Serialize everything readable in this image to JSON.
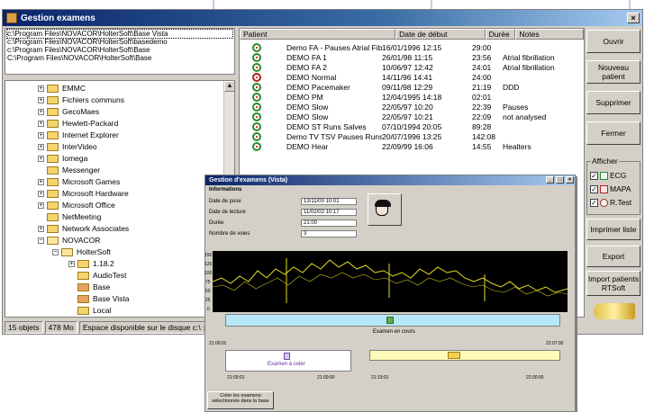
{
  "window": {
    "title": "Gestion examens",
    "close_glyph": "×"
  },
  "paths": [
    "c:\\Program Files\\NOVACOR\\HolterSoft\\Base Vista",
    "c:\\Program Files\\NOVACOR\\HolterSoft\\basedemo",
    "c:\\Program Files\\NOVACOR\\HolterSoft\\Base",
    "C:\\Program Files\\NOVACOR\\HolterSoft\\Base"
  ],
  "tree": {
    "items": [
      {
        "label": "EMMC",
        "pm": "+"
      },
      {
        "label": "Fichiers communs",
        "pm": "+"
      },
      {
        "label": "GecoMaes",
        "pm": "+"
      },
      {
        "label": "Hewlett-Packard",
        "pm": "+"
      },
      {
        "label": "Internet Explorer",
        "pm": "+"
      },
      {
        "label": "InterVideo",
        "pm": "+"
      },
      {
        "label": "Iomega",
        "pm": "+"
      },
      {
        "label": "Messenger",
        "pm": ""
      },
      {
        "label": "Microsoft Games",
        "pm": "+"
      },
      {
        "label": "Microsoft Hardware",
        "pm": "+"
      },
      {
        "label": "Microsoft Office",
        "pm": "+"
      },
      {
        "label": "NetMeeting",
        "pm": ""
      },
      {
        "label": "Network Associates",
        "pm": "+"
      },
      {
        "label": "NOVACOR",
        "pm": "−"
      },
      {
        "label": "HolterSoft",
        "pm": "−"
      },
      {
        "label": "1.18.2",
        "pm": "+"
      },
      {
        "label": "AudioTest",
        "pm": ""
      },
      {
        "label": "Base",
        "pm": ""
      },
      {
        "label": "Base Vista",
        "pm": ""
      },
      {
        "label": "Local",
        "pm": ""
      }
    ],
    "scroll_up": "▲"
  },
  "status": {
    "objects": "15 objets",
    "size": "478 Mo",
    "disk": "Espace disponible sur le disque c:\\ :"
  },
  "table": {
    "headers": [
      "Patient",
      "Date de début",
      "Durée",
      "Notes"
    ],
    "rows": [
      {
        "patient": "Demo FA - Pauses Atrial Fibrill...",
        "date": "16/01/1996 12:15",
        "duree": "29:00",
        "notes": ""
      },
      {
        "patient": "DEMO FA 1",
        "date": "26/01/98 11:15",
        "duree": "23:56",
        "notes": "Atrial fibrillation"
      },
      {
        "patient": "DEMO FA 2",
        "date": "10/06/97 12:42",
        "duree": "24:01",
        "notes": "Atrial fibrillation"
      },
      {
        "patient": "DEMO Normal",
        "date": "14/11/96 14:41",
        "duree": "24:00",
        "notes": ""
      },
      {
        "patient": "DEMO Pacemaker",
        "date": "09/11/98 12:29",
        "duree": "21:19",
        "notes": "DDD"
      },
      {
        "patient": "DEMO PM",
        "date": "12/04/1995 14:18",
        "duree": "02:01",
        "notes": ""
      },
      {
        "patient": "DEMO Slow",
        "date": "22/05/97 10:20",
        "duree": "22:39",
        "notes": "Pauses"
      },
      {
        "patient": "DEMO Slow",
        "date": "22/05/97 10:21",
        "duree": "22:09",
        "notes": "not analysed"
      },
      {
        "patient": "DEMO ST Runs Salves",
        "date": "07/10/1994 20:05",
        "duree": "89:28",
        "notes": ""
      },
      {
        "patient": "Demo TV  TSV  Pauses Runs...",
        "date": "20/07/1996 13:25",
        "duree": "142:08",
        "notes": ""
      },
      {
        "patient": "DEMO Hear",
        "date": "22/09/99 16:06",
        "duree": "14:55",
        "notes": "Healters"
      }
    ]
  },
  "buttons": {
    "ouvrir": "Ouvrir",
    "nouveau": "Nouveau patient",
    "supprimer": "Supprimer",
    "fermer": "Fermer",
    "imprimer": "Imprimer liste",
    "export": "Export",
    "import": "Import patients RTSoft"
  },
  "afficher": {
    "legend": "Afficher",
    "options": [
      "ECG",
      "MAPA",
      "R.Test"
    ],
    "check": "✓"
  },
  "vista": {
    "title": "Gestion d'examens (Vista)",
    "section": "Informations",
    "fields": [
      {
        "label": "Date de pose",
        "value": "13/11/00 10:01"
      },
      {
        "label": "Date de lecture",
        "value": "11/02/02 10:17"
      },
      {
        "label": "Durée",
        "value": "21:00"
      },
      {
        "label": "Nombre de voies",
        "value": "3"
      }
    ],
    "yticks": [
      "150",
      "125",
      "100",
      "75",
      "50",
      "25",
      "0"
    ],
    "status": "Examen en cours",
    "time_start": "21:00:01",
    "time_end": "22:07:00",
    "to_color": "Examen à coler",
    "left_bar_start": "21:00:01",
    "left_bar_end": "21:00:00",
    "right_bar_start": "21:19:01",
    "right_bar_end": "22:00:00",
    "footer_button": "Coler les examens sélectionnés dans la base",
    "tb_min": "_",
    "tb_max": "□",
    "tb_close": "×"
  }
}
